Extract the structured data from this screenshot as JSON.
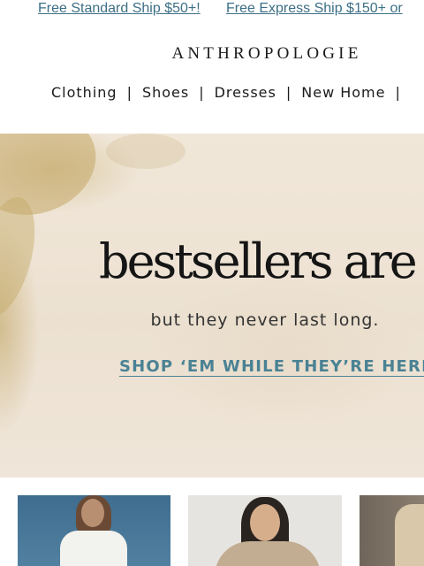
{
  "promo": {
    "standard": "Free Standard Ship $50+!",
    "express": "Free Express Ship $150+ or"
  },
  "brand": {
    "logo": "ANTHROPOLOGIE"
  },
  "nav": {
    "items": [
      {
        "label": "Clothing"
      },
      {
        "label": "Shoes"
      },
      {
        "label": "Dresses"
      },
      {
        "label": "New Home"
      }
    ],
    "separator": "|"
  },
  "hero": {
    "headline": "bestsellers are in",
    "subhead": "but they never last long.",
    "cta": "SHOP ‘EM WHILE THEY’RE HERE"
  },
  "colors": {
    "promo_link": "#3d6f86",
    "cta": "#4a8294",
    "hero_bg": "#efe5d8"
  }
}
